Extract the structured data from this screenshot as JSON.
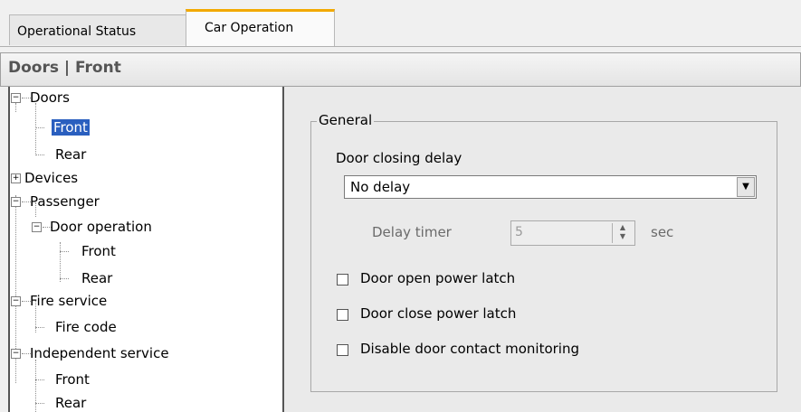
{
  "tabs": [
    {
      "label": "Operational Status"
    },
    {
      "label": "Car Operation"
    }
  ],
  "header": {
    "title": "Doors | Front"
  },
  "tree": {
    "doors": "Doors",
    "doors_front": "Front",
    "doors_rear": "Rear",
    "devices": "Devices",
    "passenger": "Passenger",
    "door_operation": "Door operation",
    "door_operation_front": "Front",
    "door_operation_rear": "Rear",
    "fire_service": "Fire service",
    "fire_code": "Fire code",
    "independent_service": "Independent service",
    "independent_front": "Front",
    "independent_rear": "Rear"
  },
  "general": {
    "title": "General",
    "door_closing_delay_label": "Door closing delay",
    "door_closing_delay_value": "No delay",
    "delay_timer_label": "Delay timer",
    "delay_timer_value": "5",
    "delay_timer_unit": "sec",
    "checkboxes": [
      {
        "label": "Door open power latch",
        "checked": false
      },
      {
        "label": "Door close power latch",
        "checked": false
      },
      {
        "label": "Disable door contact monitoring",
        "checked": false
      }
    ]
  },
  "colors": {
    "tab_accent": "#f2a900",
    "selection": "#2a5fbf"
  }
}
